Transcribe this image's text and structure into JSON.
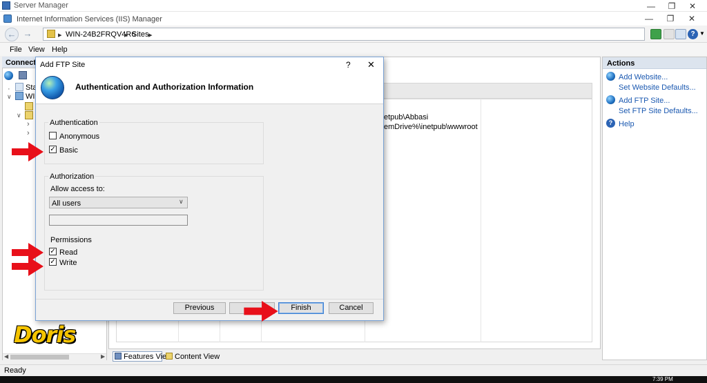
{
  "server_manager": {
    "title": "Server Manager"
  },
  "iis": {
    "title": "Internet Information Services (IIS) Manager"
  },
  "window_controls": {
    "minimize": "—",
    "restore": "❐",
    "close": "✕"
  },
  "address_bar": {
    "segments": [
      "WIN-24B2FRQV4R6",
      "Sites"
    ],
    "separator": "▸"
  },
  "menu": {
    "items": [
      "File",
      "View",
      "Help"
    ]
  },
  "connections": {
    "header": "Connecti",
    "tree": [
      "Star",
      "WIN"
    ]
  },
  "center": {
    "rows": [
      "etpub\\Abbasi",
      "emDrive%\\inetpub\\wwwroot"
    ]
  },
  "actions": {
    "header": "Actions",
    "items": [
      {
        "label": "Add Website...",
        "has_icon": true
      },
      {
        "label": "Set Website Defaults...",
        "has_icon": false
      },
      {
        "label": "Add FTP Site...",
        "has_icon": true
      },
      {
        "label": "Set FTP Site Defaults...",
        "has_icon": false
      },
      {
        "label": "Help",
        "has_icon": true
      }
    ]
  },
  "view_tabs": {
    "features": "Features View",
    "content": "Content View"
  },
  "status": {
    "text": "Ready",
    "clock": "7:39 PM"
  },
  "dialog": {
    "title": "Add FTP Site",
    "help": "?",
    "close": "✕",
    "heading": "Authentication and Authorization Information",
    "authentication": {
      "label": "Authentication",
      "anonymous": {
        "label": "Anonymous",
        "checked": false
      },
      "basic": {
        "label": "Basic",
        "checked": true
      }
    },
    "authorization": {
      "label": "Authorization",
      "allow_label": "Allow access to:",
      "allow_value": "All users",
      "text_value": "",
      "permissions_label": "Permissions",
      "read": {
        "label": "Read",
        "checked": true
      },
      "write": {
        "label": "Write",
        "checked": true
      }
    },
    "buttons": {
      "previous": "Previous",
      "next": "",
      "finish": "Finish",
      "cancel": "Cancel"
    }
  },
  "watermark": {
    "text": "Doris"
  },
  "colors": {
    "arrow": "#e8101a",
    "link": "#1a58b0",
    "accent": "#3c7fd1",
    "watermark": "#f5c400"
  },
  "check_glyph": "✓"
}
